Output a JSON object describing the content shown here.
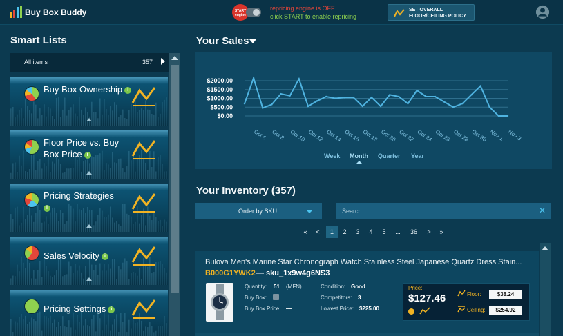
{
  "header": {
    "brand": "Buy Box Buddy",
    "start_button": "START engine",
    "status_line1": "repricing engine is OFF",
    "status_line2": "click START to enable repricing",
    "policy_button": "SET OVERALL FLOOR/CEILING POLICY",
    "colors": {
      "off": "#e2463a",
      "hint": "#8fd14f",
      "accent": "#f1b323"
    }
  },
  "sidebar": {
    "title": "Smart Lists",
    "all_items": {
      "label": "All items",
      "count": "357"
    },
    "cards": [
      {
        "title": "Buy Box Ownership",
        "icon": "pie-chart-icon"
      },
      {
        "title": "Floor Price vs. Buy Box Price",
        "icon": "pie-chart-icon"
      },
      {
        "title": "Pricing Strategies",
        "icon": "pie-chart-icon"
      },
      {
        "title": "Sales Velocity",
        "icon": "pie-chart-icon"
      },
      {
        "title": "Pricing Settings",
        "icon": "pie-chart-icon"
      }
    ]
  },
  "sales": {
    "title": "Your Sales",
    "periods": [
      "Week",
      "Month",
      "Quarter",
      "Year"
    ],
    "active_period": "Month"
  },
  "chart_data": {
    "type": "line",
    "title": "",
    "xlabel": "",
    "ylabel": "",
    "ylim": [
      0,
      2000
    ],
    "yticks": [
      "$2000.00",
      "$1500.00",
      "$1000.00",
      "$500.00",
      "$0.00"
    ],
    "grid": true,
    "xticks": [
      "Oct 6",
      "Oct 8",
      "Oct 10",
      "Oct 12",
      "Oct 14",
      "Oct 16",
      "Oct 18",
      "Oct 20",
      "Oct 22",
      "Oct 24",
      "Oct 26",
      "Oct 28",
      "Oct 30",
      "Nov 1",
      "Nov 3"
    ],
    "x": [
      "Oct 5",
      "Oct 6",
      "Oct 7",
      "Oct 8",
      "Oct 9",
      "Oct 10",
      "Oct 11",
      "Oct 12",
      "Oct 13",
      "Oct 14",
      "Oct 15",
      "Oct 16",
      "Oct 17",
      "Oct 18",
      "Oct 19",
      "Oct 20",
      "Oct 21",
      "Oct 22",
      "Oct 23",
      "Oct 24",
      "Oct 25",
      "Oct 26",
      "Oct 27",
      "Oct 28",
      "Oct 29",
      "Oct 30",
      "Oct 31",
      "Nov 1",
      "Nov 2",
      "Nov 3"
    ],
    "series": [
      {
        "values": [
          700,
          2150,
          450,
          650,
          1250,
          1150,
          2100,
          550,
          850,
          1100,
          1000,
          1050,
          1050,
          550,
          1050,
          550,
          1200,
          1100,
          700,
          1450,
          1100,
          1100,
          800,
          500,
          700,
          1200,
          1700,
          500,
          0,
          0
        ]
      }
    ]
  },
  "inventory": {
    "title": "Your Inventory (357)",
    "order_by": "Order by SKU",
    "search_placeholder": "Search...",
    "pager": [
      "«",
      "<",
      "1",
      "2",
      "3",
      "4",
      "5",
      "...",
      "36",
      ">",
      "»"
    ],
    "active_page": "1",
    "product": {
      "title": "Bulova Men's Marine Star Chronograph Watch Stainless Steel Japanese Quartz Dress Stain...",
      "asin": "B000G1YWK2",
      "sku": "— sku_1x9w4g6NS3",
      "quantity_label": "Quantity:",
      "quantity_value": "51",
      "quantity_type": "(MFN)",
      "buybox_label": "Buy Box:",
      "buybox_price_label": "Buy Box Price:",
      "buybox_price_value": "—",
      "condition_label": "Condition:",
      "condition_value": "Good",
      "competitors_label": "Competitors:",
      "competitors_value": "3",
      "lowest_label": "Lowest Price:",
      "lowest_value": "$225.00",
      "price_label": "Price:",
      "price_value": "$127.46",
      "floor_label": "Floor:",
      "floor_value": "$38.24",
      "ceiling_label": "Ceiling:",
      "ceiling_value": "$254.92"
    }
  }
}
